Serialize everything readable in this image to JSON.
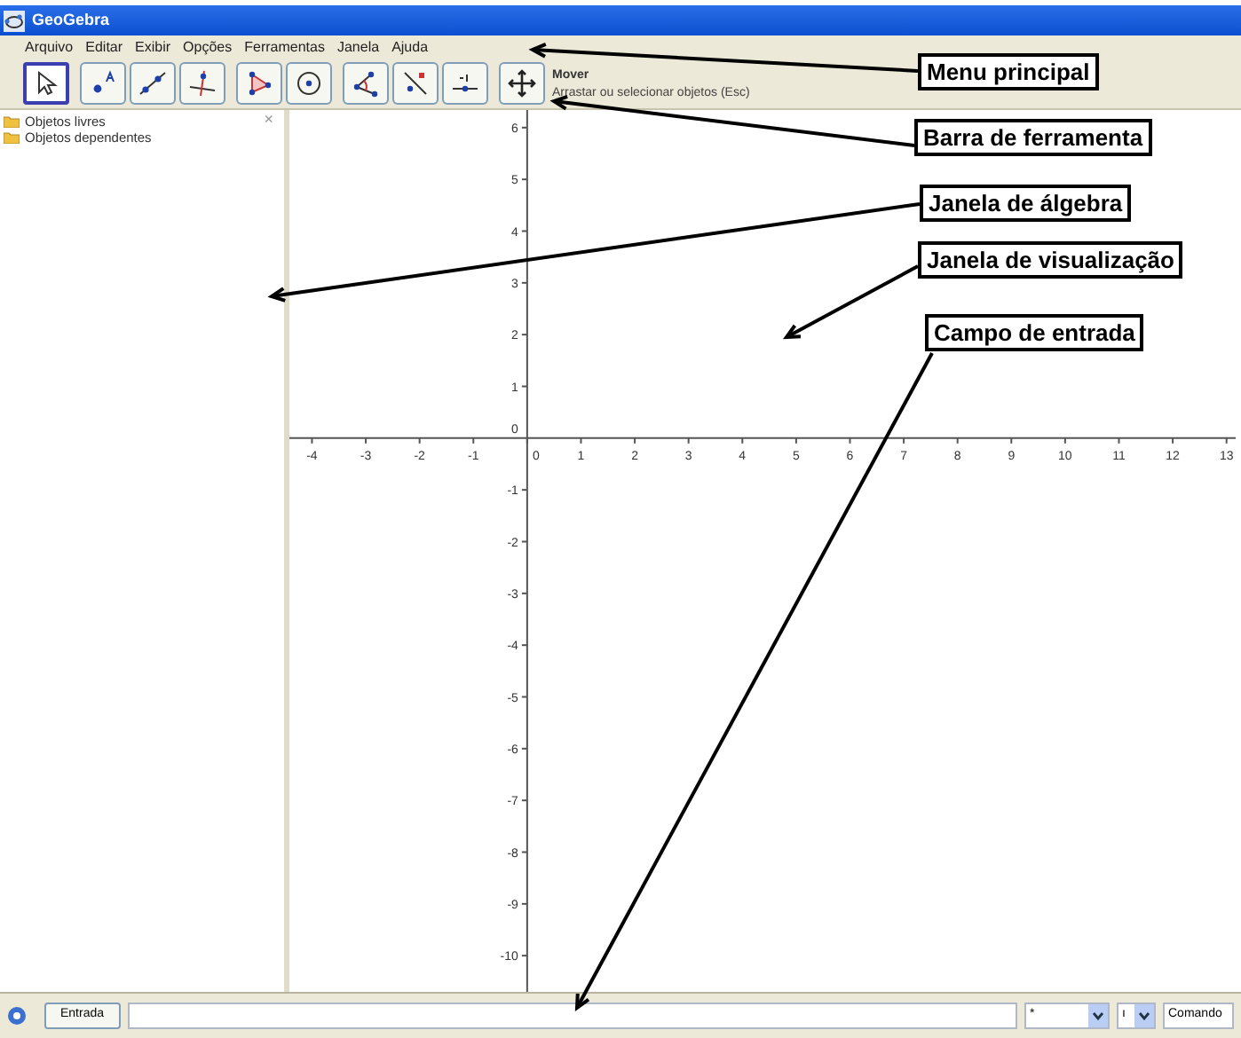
{
  "window": {
    "title": "GeoGebra"
  },
  "menu": [
    "Arquivo",
    "Editar",
    "Exibir",
    "Opções",
    "Ferramentas",
    "Janela",
    "Ajuda"
  ],
  "tools": [
    {
      "kind": "pointer",
      "selected": true
    },
    {
      "kind": "point",
      "selected": false
    },
    {
      "kind": "line",
      "selected": false
    },
    {
      "kind": "perpendicular",
      "selected": false
    },
    {
      "kind": "polygon",
      "selected": false
    },
    {
      "kind": "circle",
      "selected": false
    },
    {
      "kind": "angle",
      "selected": false
    },
    {
      "kind": "reflect",
      "selected": false
    },
    {
      "kind": "slider",
      "selected": false
    },
    {
      "kind": "move_view",
      "selected": false
    }
  ],
  "tool_info": {
    "name": "Mover",
    "help": "Arrastar ou selecionar objetos (Esc)"
  },
  "algebra": {
    "close": "×",
    "folders": [
      "Objetos livres",
      "Objetos dependentes"
    ]
  },
  "graphics": {
    "chart_data": {
      "type": "line",
      "xlim": [
        -4.42,
        13.17
      ],
      "ylim": [
        -10.7,
        6.34
      ],
      "xticks": [
        {
          "value": -4,
          "label": "-4"
        },
        {
          "value": -3,
          "label": "-3"
        },
        {
          "value": -2,
          "label": "-2"
        },
        {
          "value": -1,
          "label": "-1"
        },
        {
          "value": 0,
          "label": "0"
        },
        {
          "value": 1,
          "label": "1"
        },
        {
          "value": 2,
          "label": "2"
        },
        {
          "value": 3,
          "label": "3"
        },
        {
          "value": 4,
          "label": "4"
        },
        {
          "value": 5,
          "label": "5"
        },
        {
          "value": 6,
          "label": "6"
        },
        {
          "value": 7,
          "label": "7"
        },
        {
          "value": 8,
          "label": "8"
        },
        {
          "value": 9,
          "label": "9"
        },
        {
          "value": 10,
          "label": "10"
        },
        {
          "value": 11,
          "label": "11"
        },
        {
          "value": 12,
          "label": "12"
        },
        {
          "value": 13,
          "label": "13"
        }
      ],
      "yticks": [
        {
          "value": 6,
          "label": "6"
        },
        {
          "value": 5,
          "label": "5"
        },
        {
          "value": 4,
          "label": "4"
        },
        {
          "value": 3,
          "label": "3"
        },
        {
          "value": 2,
          "label": "2"
        },
        {
          "value": 1,
          "label": "1"
        },
        {
          "value": -1,
          "label": "-1"
        },
        {
          "value": -2,
          "label": "-2"
        },
        {
          "value": -3,
          "label": "-3"
        },
        {
          "value": -4,
          "label": "-4"
        },
        {
          "value": -5,
          "label": "-5"
        },
        {
          "value": -6,
          "label": "-6"
        },
        {
          "value": -7,
          "label": "-7"
        },
        {
          "value": -8,
          "label": "-8"
        },
        {
          "value": -9,
          "label": "-9"
        },
        {
          "value": -10,
          "label": "-10"
        }
      ]
    },
    "origin_label": "0"
  },
  "input_bar": {
    "button": "Entrada",
    "symbol_list": "*",
    "greek_list": "ı",
    "command_list": "Comando"
  },
  "callouts": [
    "Menu principal",
    "Barra de ferramenta",
    "Janela de álgebra",
    "Janela de visualização",
    "Campo de entrada"
  ]
}
